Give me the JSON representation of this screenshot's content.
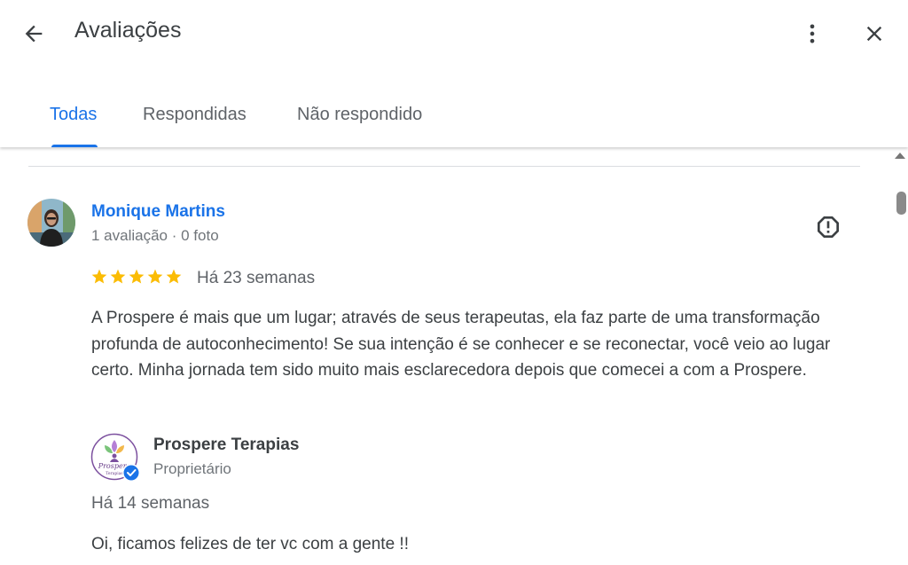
{
  "header": {
    "title": "Avaliações"
  },
  "tabs": [
    {
      "label": "Todas",
      "active": true
    },
    {
      "label": "Respondidas",
      "active": false
    },
    {
      "label": "Não respondido",
      "active": false
    }
  ],
  "review": {
    "reviewer_name": "Monique Martins",
    "reviewer_meta": "1 avaliação · 0 foto",
    "rating": 5,
    "date": "Há 23 semanas",
    "text": "A Prospere é mais que um lugar; através de seus terapeutas, ela faz parte de uma transformação profunda de autoconhecimento! Se sua intenção é se conhecer e se reconectar, você veio ao lugar certo. Minha jornada tem sido muito mais esclarecedora depois que comecei a com a Prospere.",
    "owner_reply": {
      "name": "Prospere Terapias",
      "role": "Proprietário",
      "logo_text": "Prospere",
      "logo_subtext": "Terapias",
      "date": "Há 14 semanas",
      "text": "Oi, ficamos felizes de ter vc com a gente !!"
    }
  },
  "colors": {
    "accent": "#1a73e8",
    "star": "#fbbc04",
    "verified": "#1a73e8",
    "text_secondary": "#5f6368"
  },
  "icons": {
    "back": "arrow-back-icon",
    "more": "more-vert-icon",
    "close": "close-icon",
    "report": "report-icon",
    "star": "star-icon",
    "verified": "verified-icon"
  }
}
